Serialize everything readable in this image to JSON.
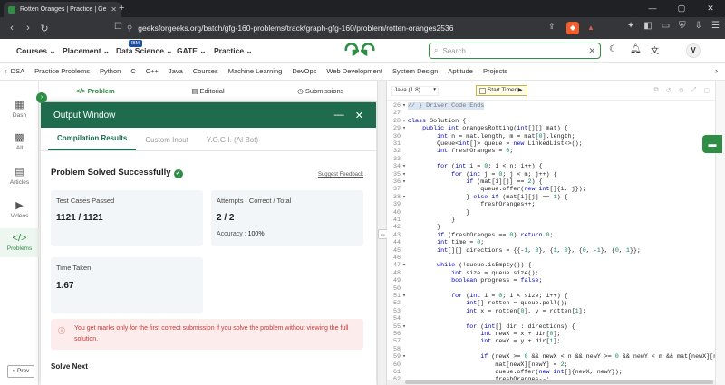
{
  "browser": {
    "tab_title": "Rotten Oranges | Practice | Gee",
    "url": "geeksforgeeks.org/batch/gfg-160-problems/track/graph-gfg-160/problem/rotten-oranges2536"
  },
  "header": {
    "menus": [
      "Courses",
      "Placement",
      "Data Science",
      "GATE",
      "Practice"
    ],
    "ibm_badge": "IBM",
    "search_placeholder": "Search..."
  },
  "avatar_letter": "V",
  "subnav": [
    "DSA",
    "Practice Problems",
    "Python",
    "C",
    "C++",
    "Java",
    "Courses",
    "Machine Learning",
    "DevOps",
    "Web Development",
    "System Design",
    "Aptitude",
    "Projects"
  ],
  "rail": [
    {
      "label": "Dash",
      "icon": "dash-icon"
    },
    {
      "label": "All",
      "icon": "all-icon"
    },
    {
      "label": "Articles",
      "icon": "articles-icon"
    },
    {
      "label": "Videos",
      "icon": "videos-icon"
    },
    {
      "label": "Problems",
      "icon": "problems-icon"
    }
  ],
  "prev_label": "Prev",
  "problem_tabs": [
    "Problem",
    "Editorial",
    "Submissions"
  ],
  "output": {
    "title": "Output Window",
    "tabs": [
      "Compilation Results",
      "Custom Input",
      "Y.O.G.I. (AI Bot)"
    ],
    "status": "Problem Solved Successfully",
    "feedback": "Suggest Feedback",
    "test_cases_label": "Test Cases Passed",
    "test_cases_value": "1121 / 1121",
    "attempts_label": "Attempts : Correct / Total",
    "attempts_value": "2 / 2",
    "accuracy_label": "Accuracy :",
    "accuracy_value": "100%",
    "time_label": "Time Taken",
    "time_value": "1.67",
    "warning": "You get marks only for the first correct submission if you solve the problem without viewing the full solution.",
    "solve_next": "Solve Next"
  },
  "editor": {
    "language": "Java (1.8)",
    "timer_label": "Start Timer",
    "lines": [
      {
        "n": "26",
        "f": "▾",
        "t": "// } Driver Code Ends",
        "hl": true
      },
      {
        "n": "27",
        "f": "",
        "t": ""
      },
      {
        "n": "28",
        "f": "▾",
        "t": "class Solution {"
      },
      {
        "n": "29",
        "f": "▾",
        "t": "    public int orangesRotting(int[][] mat) {"
      },
      {
        "n": "30",
        "f": "",
        "t": "        int n = mat.length, m = mat[0].length;"
      },
      {
        "n": "31",
        "f": "",
        "t": "        Queue<int[]> queue = new LinkedList<>();"
      },
      {
        "n": "32",
        "f": "",
        "t": "        int freshOranges = 0;"
      },
      {
        "n": "33",
        "f": "",
        "t": ""
      },
      {
        "n": "34",
        "f": "▾",
        "t": "        for (int i = 0; i < n; i++) {"
      },
      {
        "n": "35",
        "f": "▾",
        "t": "            for (int j = 0; j < m; j++) {"
      },
      {
        "n": "36",
        "f": "▾",
        "t": "                if (mat[i][j] == 2) {"
      },
      {
        "n": "37",
        "f": "",
        "t": "                    queue.offer(new int[]{i, j});"
      },
      {
        "n": "38",
        "f": "▾",
        "t": "                } else if (mat[i][j] == 1) {"
      },
      {
        "n": "39",
        "f": "",
        "t": "                    freshOranges++;"
      },
      {
        "n": "40",
        "f": "",
        "t": "                }"
      },
      {
        "n": "41",
        "f": "",
        "t": "            }"
      },
      {
        "n": "42",
        "f": "",
        "t": "        }"
      },
      {
        "n": "43",
        "f": "",
        "t": "        if (freshOranges == 0) return 0;"
      },
      {
        "n": "44",
        "f": "",
        "t": "        int time = 0;"
      },
      {
        "n": "45",
        "f": "",
        "t": "        int[][] directions = {{-1, 0}, {1, 0}, {0, -1}, {0, 1}};"
      },
      {
        "n": "46",
        "f": "",
        "t": ""
      },
      {
        "n": "47",
        "f": "▾",
        "t": "        while (!queue.isEmpty()) {"
      },
      {
        "n": "48",
        "f": "",
        "t": "            int size = queue.size();"
      },
      {
        "n": "49",
        "f": "",
        "t": "            boolean progress = false;"
      },
      {
        "n": "50",
        "f": "",
        "t": ""
      },
      {
        "n": "51",
        "f": "▾",
        "t": "            for (int i = 0; i < size; i++) {"
      },
      {
        "n": "52",
        "f": "",
        "t": "                int[] rotten = queue.poll();"
      },
      {
        "n": "53",
        "f": "",
        "t": "                int x = rotten[0], y = rotten[1];"
      },
      {
        "n": "54",
        "f": "",
        "t": ""
      },
      {
        "n": "55",
        "f": "▾",
        "t": "                for (int[] dir : directions) {"
      },
      {
        "n": "56",
        "f": "",
        "t": "                    int newX = x + dir[0];"
      },
      {
        "n": "57",
        "f": "",
        "t": "                    int newY = y + dir[1];"
      },
      {
        "n": "58",
        "f": "",
        "t": ""
      },
      {
        "n": "59",
        "f": "▾",
        "t": "                    if (newX >= 0 && newX < n && newY >= 0 && newY < m && mat[newX][newY]"
      },
      {
        "n": "60",
        "f": "",
        "t": "                        mat[newX][newY] = 2;"
      },
      {
        "n": "61",
        "f": "",
        "t": "                        queue.offer(new int[]{newX, newY});"
      },
      {
        "n": "62",
        "f": "",
        "t": "                        freshOranges--;"
      }
    ]
  }
}
